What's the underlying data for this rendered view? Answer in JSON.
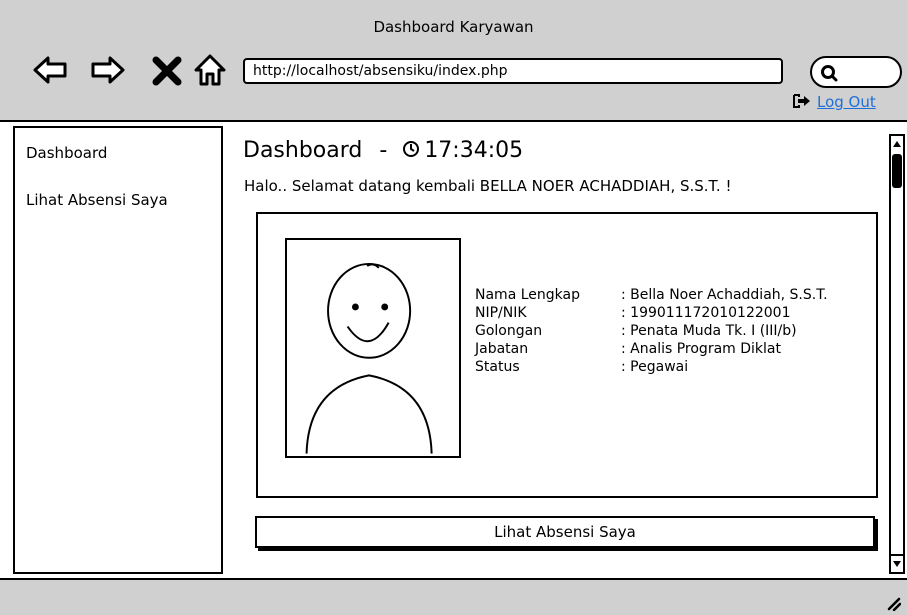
{
  "window": {
    "title": "Dashboard Karyawan",
    "url": "http://localhost/absensiku/index.php",
    "logout_label": "Log Out"
  },
  "sidebar": {
    "items": [
      {
        "label": "Dashboard"
      },
      {
        "label": "Lihat Absensi Saya"
      }
    ]
  },
  "main": {
    "title": "Dashboard",
    "separator": "-",
    "time": "17:34:05",
    "welcome": "Halo.. Selamat datang kembali BELLA NOER ACHADDIAH, S.S.T. !",
    "profile": [
      {
        "label": "Nama Lengkap",
        "value": ": Bella Noer Achaddiah, S.S.T."
      },
      {
        "label": "NIP/NIK",
        "value": ": 199011172010122001"
      },
      {
        "label": "Golongan",
        "value": ": Penata Muda Tk. I (III/b)"
      },
      {
        "label": "Jabatan",
        "value": ": Analis Program Diklat"
      },
      {
        "label": "Status",
        "value": ": Pegawai"
      }
    ],
    "action_button": "Lihat Absensi Saya"
  },
  "icons": {
    "back": "arrow-left-icon",
    "forward": "arrow-right-icon",
    "stop": "close-icon",
    "home": "home-icon",
    "search": "search-icon",
    "logout": "logout-icon",
    "clock": "clock-icon"
  },
  "colors": {
    "chrome": "#d0d0d0",
    "link": "#1e6fd9"
  }
}
